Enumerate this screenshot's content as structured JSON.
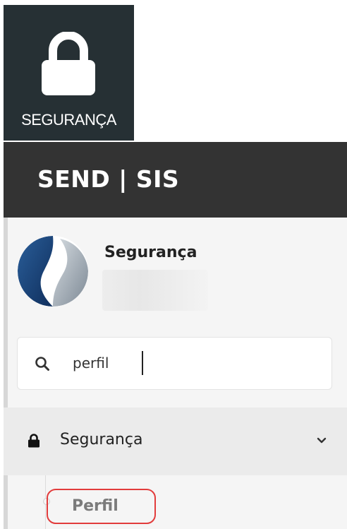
{
  "security_tile": {
    "icon": "lock-icon",
    "label": "SEGURANÇA"
  },
  "header": {
    "brand": "SEND | SIS"
  },
  "profile": {
    "title": "Segurança",
    "avatar": "logo-avatar"
  },
  "search": {
    "icon": "search-icon",
    "value": "perfil"
  },
  "menu": {
    "group_label": "Segurança",
    "group_icon": "lock-icon",
    "expand_icon": "chevron-down-icon",
    "items": [
      {
        "label": "Perfil",
        "highlighted": true
      }
    ]
  },
  "colors": {
    "tile_bg": "#263034",
    "header_bg": "#333333",
    "sidebar_bg": "#f5f5f5",
    "highlight": "#e23c3c"
  }
}
